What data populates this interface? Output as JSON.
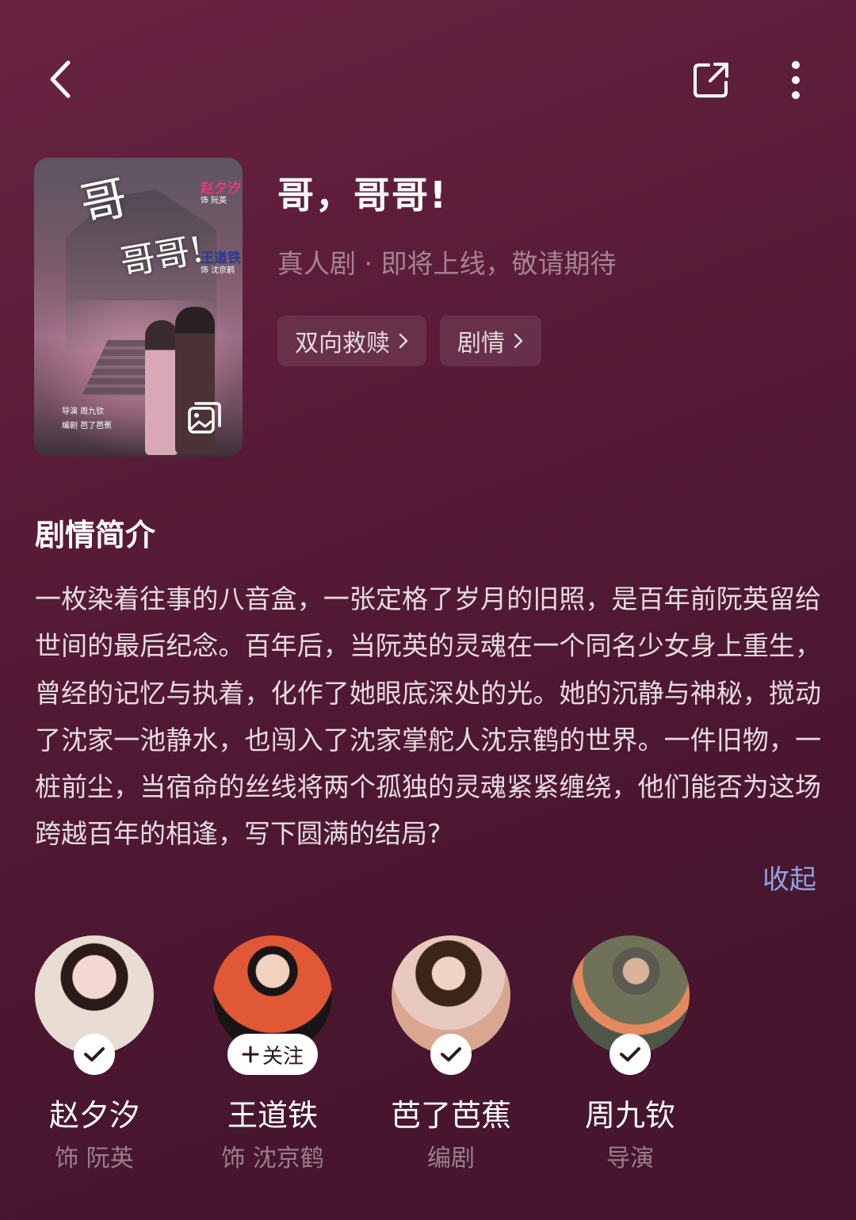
{
  "topbar": {
    "back_icon": "chevron-left-icon",
    "share_icon": "share-icon",
    "more_icon": "more-vertical-icon"
  },
  "poster": {
    "title_line1": "哥",
    "title_line2": "哥哥!",
    "cast1_name": "赵夕汐",
    "cast1_role": "饰 阮英",
    "cast2_name": "王道铁",
    "cast2_role": "饰 沈京鹤",
    "credit_director": "导演 周九钦",
    "credit_writer": "编剧 芭了芭蕉",
    "gallery_icon": "gallery-icon"
  },
  "drama": {
    "title": "哥，哥哥!",
    "subtitle": "真人剧 · 即将上线，敬请期待",
    "tags": [
      "双向救赎",
      "剧情"
    ]
  },
  "synopsis": {
    "heading": "剧情简介",
    "text": "一枚染着往事的八音盒，一张定格了岁月的旧照，是百年前阮英留给世间的最后纪念。百年后，当阮英的灵魂在一个同名少女身上重生，曾经的记忆与执着，化作了她眼底深处的光。她的沉静与神秘，搅动了沈家一池静水，也闯入了沈家掌舵人沈京鹤的世界。一件旧物，一桩前尘，当宿命的丝线将两个孤独的灵魂紧紧缠绕，他们能否为这场跨越百年的相逢，写下圆满的结局?",
    "collapse_label": "收起"
  },
  "people": [
    {
      "name": "赵夕汐",
      "role": "饰 阮英",
      "followed": true
    },
    {
      "name": "王道铁",
      "role": "饰 沈京鹤",
      "followed": false,
      "follow_label": "关注"
    },
    {
      "name": "芭了芭蕉",
      "role": "编剧",
      "followed": true
    },
    {
      "name": "周九钦",
      "role": "导演",
      "followed": true
    }
  ],
  "colors": {
    "background": "#55193a",
    "link": "#8ea4e0"
  }
}
